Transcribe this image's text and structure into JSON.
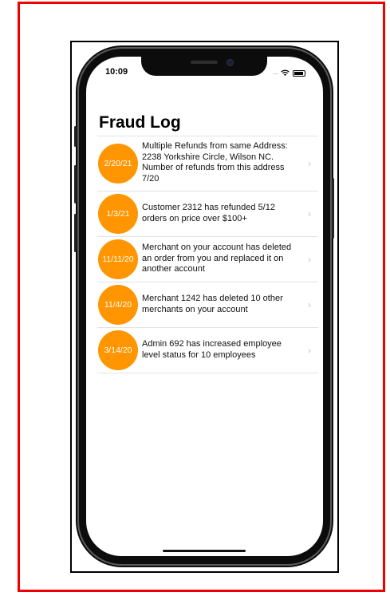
{
  "status_bar": {
    "time": "10:09",
    "signal_dots": "····"
  },
  "header": {
    "title": "Fraud Log"
  },
  "fraud_log": {
    "items": [
      {
        "date": "2/20/21",
        "text": "Multiple Refunds from same Address: 2238 Yorkshire Circle, Wilson NC. Number of refunds from this address 7/20"
      },
      {
        "date": "1/3/21",
        "text": "Customer 2312 has refunded 5/12 orders on price over $100+"
      },
      {
        "date": "11/11/20",
        "text": "Merchant on your account has deleted an order from you and replaced it on another account"
      },
      {
        "date": "11/4/20",
        "text": "Merchant 1242 has deleted 10 other merchants on your account"
      },
      {
        "date": "3/14/20",
        "text": "Admin 692 has increased employee level status for 10 employees"
      }
    ]
  },
  "chevron_glyph": "›",
  "colors": {
    "badge": "#ff9500",
    "frame_red": "#ee0000",
    "separator": "#e3e3e3"
  },
  "icons": {
    "wifi": "wifi-icon",
    "battery": "battery-icon",
    "chevron": "chevron-right-icon"
  }
}
